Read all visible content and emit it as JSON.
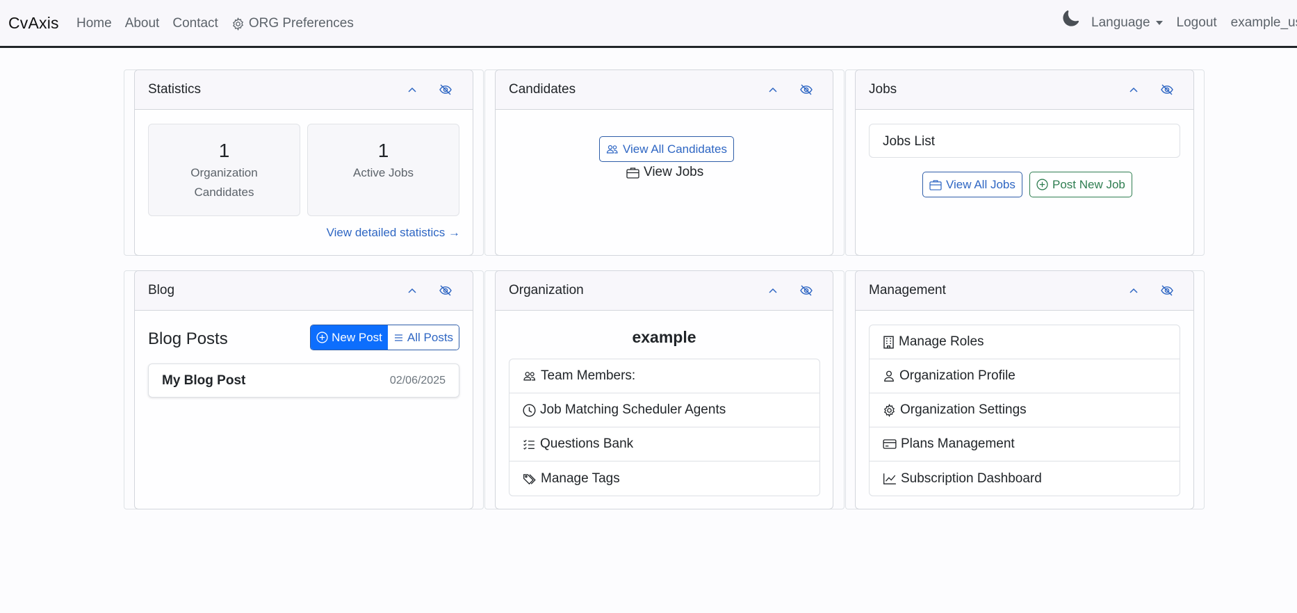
{
  "navbar": {
    "brand": "CvAxis",
    "links": [
      "Home",
      "About",
      "Contact"
    ],
    "org_preferences": "ORG Preferences",
    "language": "Language",
    "logout": "Logout",
    "user": "example_us"
  },
  "statistics": {
    "title": "Statistics",
    "candidates_count": "1",
    "candidates_label_1": "Organization",
    "candidates_label_2": "Candidates",
    "jobs_count": "1",
    "jobs_label": "Active Jobs",
    "details_link": "View detailed statistics →"
  },
  "candidates": {
    "title": "Candidates",
    "view_all": "View All Candidates",
    "view_jobs": "View Jobs"
  },
  "jobs": {
    "title": "Jobs",
    "list_title": "Jobs List",
    "view_all": "View All Jobs",
    "post_new": "Post New Job"
  },
  "blog": {
    "title": "Blog",
    "heading": "Blog Posts",
    "new_post": "New Post",
    "all_posts": "All Posts",
    "posts": [
      {
        "title": "My Blog Post",
        "date": "02/06/2025"
      }
    ]
  },
  "organization": {
    "title": "Organization",
    "name": "example",
    "items": [
      "Team Members:",
      "Job Matching Scheduler Agents",
      "Questions Bank",
      "Manage Tags"
    ]
  },
  "management": {
    "title": "Management",
    "items": [
      "Manage Roles",
      "Organization Profile",
      "Organization Settings",
      "Plans Management",
      "Subscription Dashboard"
    ]
  },
  "colors": {
    "primary": "#0d6efd",
    "link": "#2e66c3",
    "success": "#2e7d50",
    "navbar_bg": "#f8f7fb"
  }
}
